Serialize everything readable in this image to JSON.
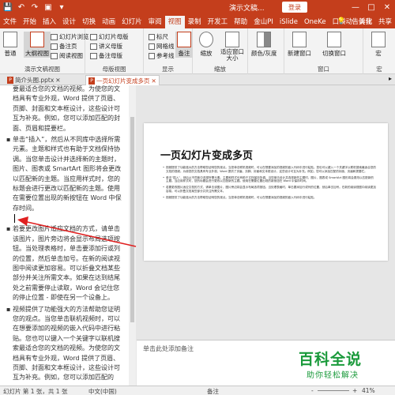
{
  "title_bar": {
    "doc_title": "演示文稿...",
    "login": "登录",
    "minimize": "—",
    "restore": "□",
    "close": "✕",
    "quick_access": [
      "💾",
      "↶",
      "↷",
      "▣",
      "▾"
    ]
  },
  "menu": {
    "tabs": [
      "文件",
      "开始",
      "插入",
      "设计",
      "切换",
      "动画",
      "幻灯片",
      "审阅",
      "视图",
      "录制",
      "开发工",
      "帮助",
      "金山PI",
      "iSlide",
      "OneKe",
      "口袋动",
      "美化"
    ],
    "active": "视图",
    "help_icon": "💡",
    "tell_me": "告诉我",
    "share": "共享"
  },
  "ribbon": {
    "presentation_views": {
      "label": "演示文稿视图",
      "normal": "普通",
      "outline": "大纲视图",
      "slide_sorter": "幻灯片浏览",
      "notes_page": "备注页",
      "reading": "阅读视图"
    },
    "master_views": {
      "label": "母版视图",
      "slide_master": "幻灯片母版",
      "handout_master": "讲义母版",
      "notes_master": "备注母版"
    },
    "show": {
      "label": "显示",
      "ruler": "标尺",
      "gridlines": "网格线",
      "guides": "参考线",
      "notes": "备注"
    },
    "zoom": {
      "label": "缩放",
      "zoom": "缩放",
      "fit": "适应窗口大小"
    },
    "color": {
      "label": "颜色/灰度",
      "color_grey": "颜色/灰度"
    },
    "window": {
      "label": "窗口",
      "new_window": "新建窗口",
      "switch_window": "切换窗口"
    },
    "macros": {
      "label": "宏",
      "macros": "宏"
    }
  },
  "doc_tabs": {
    "tab1": "简介头图.pptx",
    "tab2": "一页幻灯片变成多页",
    "close": "✕",
    "scroll": "▸"
  },
  "outline": {
    "p1": "要最适合您的文档的视频。为使您的文档具有专业外观，Word 提供了页眉、页脚、封面和文本框设计，这些设计可互为补充。例如，您可以添加匹配的封面、页眉和提要栏。",
    "p2": "单击“插入”，然后从不同库中选择所需元素。主题和样式也有助于文档保持协调。当您单击设计并选择新的主题时，图片、图表或 SmartArt 图形将会更改以匹配新的主题。当应用样式时，您的标题会进行更改以匹配新的主题。使用在需要位置出现的新按钮在 Word 中保存时间。",
    "p3": "若要更改图片适应文档的方式，请单击该图片，图片旁边将会显示布局选项按钮。当处理表格时，单击要添加行或列的位置，然后单击加号。在新的阅读视图中阅读更加容易。可以折叠文档某些部分并关注所需文本。如果在达到结尾处之前需要停止读取，Word 会记住您的停止位置 - 即使在另一个设备上。",
    "p4": "视频提供了功能强大的方法帮助您证明您的观点。当您单击联机视频时，可以在想要添加的视频的嵌入代码中进行粘贴。您也可以键入一个关键字以联机搜索最适合您的文档的视频。为使您的文档具有专业外观，Word 提供了页眉、页脚、封面和文本框设计，这些设计可互为补充。例如，您可以添加匹配的"
  },
  "slide": {
    "title": "一页幻灯片变成多页",
    "b1": "视频提供了功能强大的方法帮助您证明您的观点。当您单击联机视频时，可以在想要添加的视频的嵌入代码中进行粘贴。您也可以键入一个关键字以联机搜索最适合您的文档的视频。为使您的文档具有专业外观，Word 提供了页眉、页脚、封面和文本框设计，这些设计可互为补充。例如，您可以添加匹配的封面、页眉和提要栏。",
    "b2": "单击“插入”，然后从不同库中选择所需元素。主题和样式也有助于文档保持协调。当您单击设计并选择新的主题时，图片、图表或 SmartArt 图形将会更改以匹配新的主题。当应用样式时，您的标题会进行更改以匹配新的主题。使用在需要位置出现的新按钮在 Word 中保存时间。",
    "b3": "若要更改图片适应文档的方式，请单击该图片，图片旁边将会显示布局选项按钮。当处理表格时，单击要添加行或列的位置，然后单击加号。在新的阅读视图中阅读更加容易。可以折叠文档某些部分并关注所需文本。",
    "b4": "视频提供了功能强大的方法帮助您证明您的观点。当您单击联机视频时，可以在想要添加的视频的嵌入代码中进行粘贴。"
  },
  "notes": {
    "placeholder": "单击此处添加备注"
  },
  "status": {
    "slide_count": "幻灯片 第 1 张，共 1 张",
    "language": "中文(中国)",
    "notes": "备注",
    "zoom_minus": "-",
    "zoom_plus": "+",
    "zoom_level": "41%"
  },
  "watermark": {
    "main": "百科全说",
    "sub": "助你轻松解决"
  },
  "colors": {
    "accent": "#c43e1c",
    "watermark": "#1a9a3b"
  }
}
